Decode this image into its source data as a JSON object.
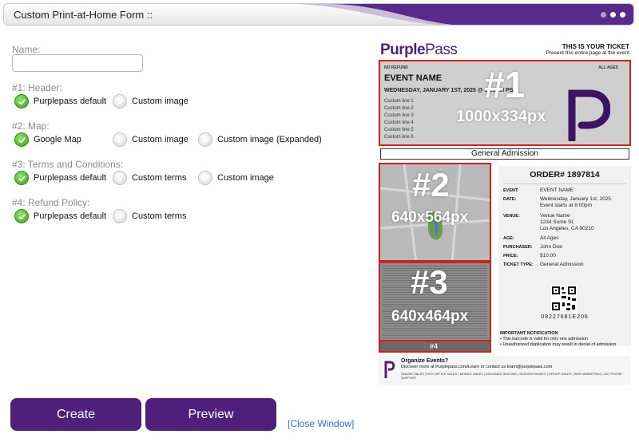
{
  "window": {
    "title": "Custom Print-at-Home Form ::"
  },
  "form": {
    "name_label": "Name:",
    "name_value": "",
    "sections": [
      {
        "label": "#1: Header:",
        "options": [
          {
            "label": "Purplepass default",
            "checked": true
          },
          {
            "label": "Custom image",
            "checked": false
          }
        ]
      },
      {
        "label": "#2: Map:",
        "options": [
          {
            "label": "Google Map",
            "checked": true
          },
          {
            "label": "Custom image",
            "checked": false
          },
          {
            "label": "Custom image (Expanded)",
            "checked": false
          }
        ]
      },
      {
        "label": "#3: Terms and Conditions:",
        "options": [
          {
            "label": "Purplepass default",
            "checked": true
          },
          {
            "label": "Custom terms",
            "checked": false
          },
          {
            "label": "Custom image",
            "checked": false
          }
        ]
      },
      {
        "label": "#4: Refund Policy:",
        "options": [
          {
            "label": "Purplepass default",
            "checked": true
          },
          {
            "label": "Custom terms",
            "checked": false
          }
        ]
      }
    ]
  },
  "actions": {
    "create": "Create",
    "preview": "Preview",
    "close": "[Close Window]"
  },
  "preview": {
    "logo_a": "Purple",
    "logo_b": "Pass",
    "your_ticket": "THIS IS YOUR TICKET",
    "your_ticket_sub": "Present this entire page at the event",
    "header": {
      "no_refund": "NO REFUND",
      "all_ages": "ALL AGES",
      "event_name": "EVENT NAME",
      "date": "WEDNESDAY, JANUARY 1ST, 2025 @ 8:00PM PST",
      "custom_lines": [
        "Custom line 1",
        "Custom line 2",
        "Custom line 3",
        "Custom line 4",
        "Custom line 5",
        "Custom line 6"
      ],
      "overlay_num": "#1",
      "overlay_size": "1000x334px"
    },
    "general_admission": "General Admission",
    "map": {
      "overlay_num": "#2",
      "overlay_size": "640x564px"
    },
    "terms": {
      "overlay_num": "#3",
      "overlay_size": "640x464px"
    },
    "refund": {
      "overlay_num": "#4"
    },
    "order": {
      "number": "ORDER# 1897814",
      "rows": [
        {
          "key": "EVENT:",
          "value": "EVENT NAME"
        },
        {
          "key": "DATE:",
          "value": "Wednesday, January 1st, 2025\nEvent starts at 8:00pm"
        },
        {
          "key": "VENUE:",
          "value": "Venue Name\n1234 Some St.\nLos Angeles, CA 90210"
        },
        {
          "key": "AGE:",
          "value": "All Ages"
        },
        {
          "key": "PURCHASER:",
          "value": "John Doe"
        },
        {
          "key": "PRICE:",
          "value": "$10.00"
        },
        {
          "key": "TICKET TYPE:",
          "value": "General Admission"
        }
      ],
      "barcode_number": "09227681E206"
    },
    "notification": {
      "title": "IMPORTANT NOTIFICATION",
      "lines": [
        "• This barcode is valid for only one admission",
        "• Unauthorized duplication may result in denial of admission"
      ]
    },
    "organize": {
      "title": "Organize Events?",
      "discover": "Discover more at Purplepass.com/Learn or contact us team@purplepass.com",
      "services": "ONLINE SALES | BOX OFFICE SALES | MOBILE SALES | ASSIGNED SEATING | SEASON PASSES | GROUP SALES | SMS MARKETING | 24/7 PHONE SUPPORT"
    }
  },
  "colors": {
    "brand": "#4f1f7c",
    "highlight": "#d02020",
    "link": "#2a6fdb",
    "check": "#4caf27"
  }
}
